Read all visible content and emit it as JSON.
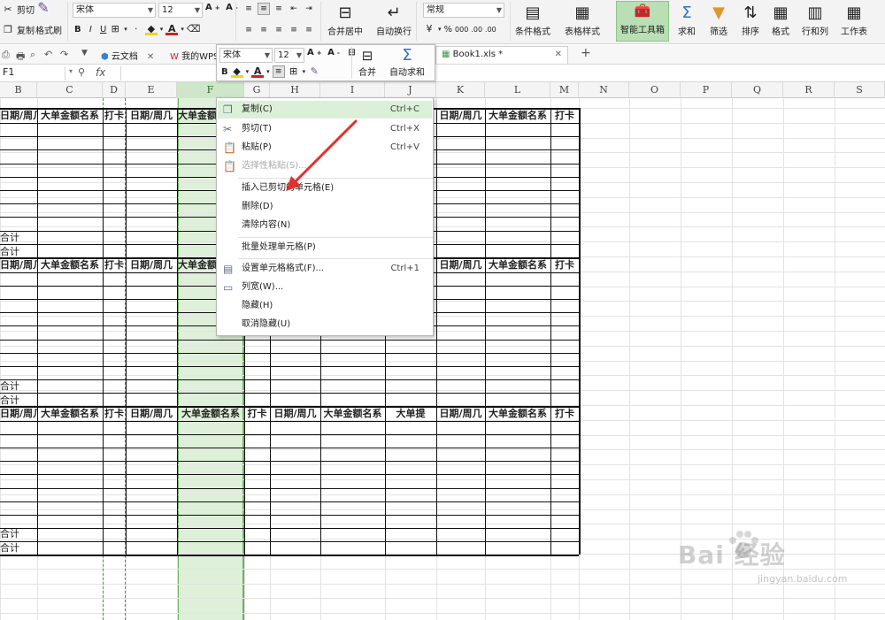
{
  "ribbon": {
    "cut": "剪切",
    "copy": "复制",
    "format_painter": "格式刷",
    "font_name": "宋体",
    "font_size": "12",
    "merge_center": "合并居中",
    "wrap_text": "自动换行",
    "number_format": "常规",
    "cond_format": "条件格式",
    "table_style": "表格样式",
    "smart_toolbox": "智能工具箱",
    "sum": "求和",
    "filter": "筛选",
    "sort": "排序",
    "format": "格式",
    "row_col": "行和列",
    "worksheet": "工作表",
    "percent": "%",
    "comma": "000",
    "inc_dec": ".00",
    "dec_dec": ".00"
  },
  "tabs": {
    "cloud_docs": "云文档",
    "my_wps": "我的WPS",
    "book": "Book1.xls *",
    "add": "+"
  },
  "formula_bar": {
    "name_box": "F1",
    "fx": "fx"
  },
  "mini_toolbar": {
    "font_name": "宋体",
    "font_size": "12",
    "merge": "合并",
    "autosum": "自动求和"
  },
  "columns": [
    "B",
    "C",
    "D",
    "E",
    "F",
    "G",
    "H",
    "I",
    "J",
    "K",
    "L",
    "M",
    "N",
    "O",
    "P",
    "Q",
    "R",
    "S"
  ],
  "table": {
    "h_date": "日期/周几",
    "h_name": "大单金额名系",
    "h_card": "打卡",
    "h_big": "大单提",
    "h_name_short": "大单金额",
    "total": "合计"
  },
  "context_menu": {
    "items": [
      {
        "label": "复制(C)",
        "shortcut": "Ctrl+C"
      },
      {
        "label": "剪切(T)",
        "shortcut": "Ctrl+X"
      },
      {
        "label": "粘贴(P)",
        "shortcut": "Ctrl+V"
      },
      {
        "label": "选择性粘贴(S)...",
        "shortcut": ""
      },
      {
        "label": "插入已剪切的单元格(E)",
        "shortcut": ""
      },
      {
        "label": "删除(D)",
        "shortcut": ""
      },
      {
        "label": "清除内容(N)",
        "shortcut": ""
      },
      {
        "label": "批量处理单元格(P)",
        "shortcut": ""
      },
      {
        "label": "设置单元格格式(F)...",
        "shortcut": "Ctrl+1"
      },
      {
        "label": "列宽(W)...",
        "shortcut": ""
      },
      {
        "label": "隐藏(H)",
        "shortcut": ""
      },
      {
        "label": "取消隐藏(U)",
        "shortcut": ""
      }
    ]
  },
  "watermark": {
    "brand": "Bai 经验",
    "url": "jingyan.baidu.com"
  },
  "colors": {
    "selection_fill": "#dff0da",
    "selection_border": "#6eb15f",
    "arrow": "#e03030",
    "menu_highlight": "#dcefd8"
  }
}
